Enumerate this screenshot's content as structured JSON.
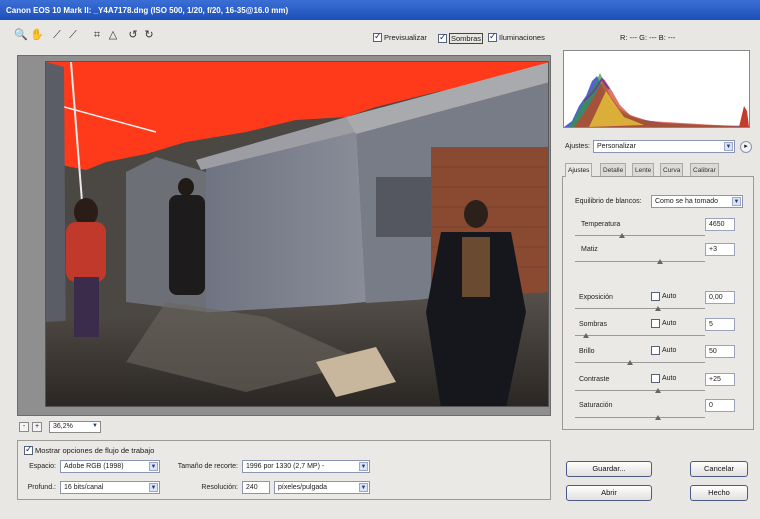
{
  "window": {
    "title": "Canon EOS 10 Mark II: _Y4A7178.dng (ISO 500, 1/20, f/20, 16-35@16.0 mm)"
  },
  "toolbar": {
    "tools": [
      "zoom-icon",
      "hand-icon",
      "white-balance-icon",
      "color-sampler-icon",
      "crop-icon",
      "straighten-icon",
      "rotate-left-icon",
      "rotate-right-icon"
    ],
    "previsualizar": "Previsualizar",
    "sombras": "Sombras",
    "iluminaciones": "Iluminaciones",
    "rgb_readout": "R: ---   G: ---   B: ---"
  },
  "zoom": {
    "minus": "-",
    "plus": "+",
    "value": "36,2%"
  },
  "workflow": {
    "toggle": "Mostrar opciones de flujo de trabajo",
    "espacio_label": "Espacio:",
    "espacio_value": "Adobe RGB (1998)",
    "profund_label": "Profund.:",
    "profund_value": "16 bits/canal",
    "tamano_label": "Tamaño de recorte:",
    "tamano_value": "1996 por 1330 (2,7 MP) -",
    "resolucion_label": "Resolución:",
    "resolucion_value": "240",
    "resolucion_unit": "píxeles/pulgada"
  },
  "settings": {
    "label": "Ajustes:",
    "value": "Personalizar"
  },
  "tabs": [
    "Ajustes",
    "Detalle",
    "Lente",
    "Curva",
    "Calibrar"
  ],
  "adjust": {
    "wb_label": "Equilibrio de blancos:",
    "wb_value": "Como se ha tomado",
    "temperatura_label": "Temperatura",
    "temperatura_value": "4650",
    "matiz_label": "Matiz",
    "matiz_value": "+3",
    "exposicion_label": "Exposición",
    "exposicion_value": "0,00",
    "sombras_label": "Sombras",
    "sombras_value": "5",
    "brillo_label": "Brillo",
    "brillo_value": "50",
    "contraste_label": "Contraste",
    "contraste_value": "+25",
    "saturacion_label": "Saturación",
    "saturacion_value": "0",
    "auto_label": "Auto"
  },
  "buttons": {
    "guardar": "Guardar...",
    "abrir": "Abrir",
    "cancelar": "Cancelar",
    "hecho": "Hecho"
  },
  "colors": {
    "clipping_overlay": "#ff3a1a",
    "titlebar": "#2a5bc7"
  }
}
